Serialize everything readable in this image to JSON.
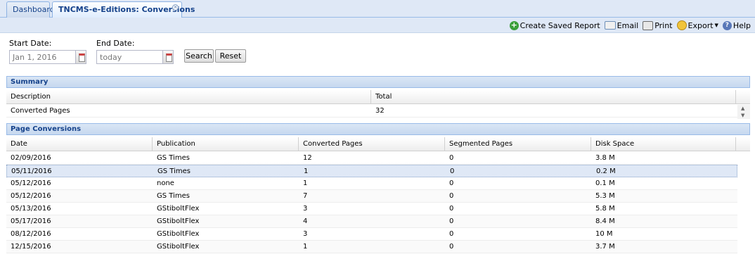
{
  "tabs": [
    {
      "label": "Dashboard"
    },
    {
      "label": "TNCMS-e-Editions: Conversions",
      "close": "×"
    }
  ],
  "toolbar": {
    "create_saved_report": "Create Saved Report",
    "email": "Email",
    "print": "Print",
    "export": "Export",
    "help": "Help"
  },
  "filter": {
    "start_label": "Start Date:",
    "start_value": "Jan 1, 2016",
    "end_label": "End Date:",
    "end_value": "today",
    "search_label": "Search",
    "reset_label": "Reset"
  },
  "summary": {
    "title": "Summary",
    "headers": [
      "Description",
      "Total"
    ],
    "rows": [
      [
        "Converted Pages",
        "32"
      ]
    ]
  },
  "conversions": {
    "title": "Page Conversions",
    "headers": [
      "Date",
      "Publication",
      "Converted Pages",
      "Segmented Pages",
      "Disk Space"
    ],
    "rows": [
      [
        "02/09/2016",
        "GS Times",
        "12",
        "0",
        "3.8 M"
      ],
      [
        "05/11/2016",
        "GS Times",
        "1",
        "0",
        "0.2 M"
      ],
      [
        "05/12/2016",
        "none",
        "1",
        "0",
        "0.1 M"
      ],
      [
        "05/12/2016",
        "GS Times",
        "7",
        "0",
        "5.3 M"
      ],
      [
        "05/13/2016",
        "GStiboltFlex",
        "3",
        "0",
        "5.8 M"
      ],
      [
        "05/17/2016",
        "GStiboltFlex",
        "4",
        "0",
        "8.4 M"
      ],
      [
        "08/12/2016",
        "GStiboltFlex",
        "3",
        "0",
        "10 M"
      ],
      [
        "12/15/2016",
        "GStiboltFlex",
        "1",
        "0",
        "3.7 M"
      ]
    ],
    "selected_row": 1
  }
}
